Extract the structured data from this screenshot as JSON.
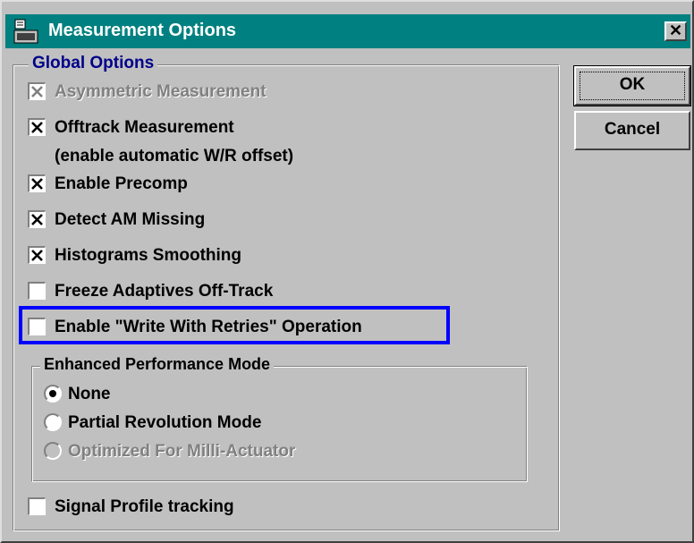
{
  "window": {
    "title": "Measurement Options",
    "close_glyph": "✕"
  },
  "global_options": {
    "legend": "Global Options",
    "items": [
      {
        "text": "Asymmetric Measurement",
        "checked": true,
        "disabled": true
      },
      {
        "text": "Offtrack Measurement",
        "checked": true,
        "disabled": false
      },
      {
        "text": "Enable Precomp",
        "checked": true,
        "disabled": false
      },
      {
        "text": "Detect AM Missing",
        "checked": true,
        "disabled": false
      },
      {
        "text": "Histograms Smoothing",
        "checked": true,
        "disabled": false
      },
      {
        "text": "Freeze Adaptives Off-Track",
        "checked": false,
        "disabled": false
      },
      {
        "text": "Enable \"Write With Retries\" Operation",
        "checked": false,
        "disabled": false,
        "highlighted": true
      }
    ],
    "offtrack_note": "(enable automatic W/R offset)"
  },
  "performance_mode": {
    "legend": "Enhanced Performance Mode",
    "options": [
      {
        "text": "None",
        "selected": true,
        "disabled": false
      },
      {
        "text": "Partial Revolution Mode",
        "selected": false,
        "disabled": false
      },
      {
        "text": "Optimized For Milli-Actuator",
        "selected": false,
        "disabled": true
      }
    ]
  },
  "signal_profile": {
    "text": "Signal Profile tracking",
    "checked": false
  },
  "buttons": {
    "ok": "OK",
    "cancel": "Cancel"
  },
  "colors": {
    "titlebar": "#008080",
    "highlight_border": "#0000ff",
    "legend_blue": "#00008b",
    "face": "#c0c0c0"
  },
  "icons": {
    "app": "app-icon",
    "close": "close-icon",
    "check": "check-x-icon"
  }
}
